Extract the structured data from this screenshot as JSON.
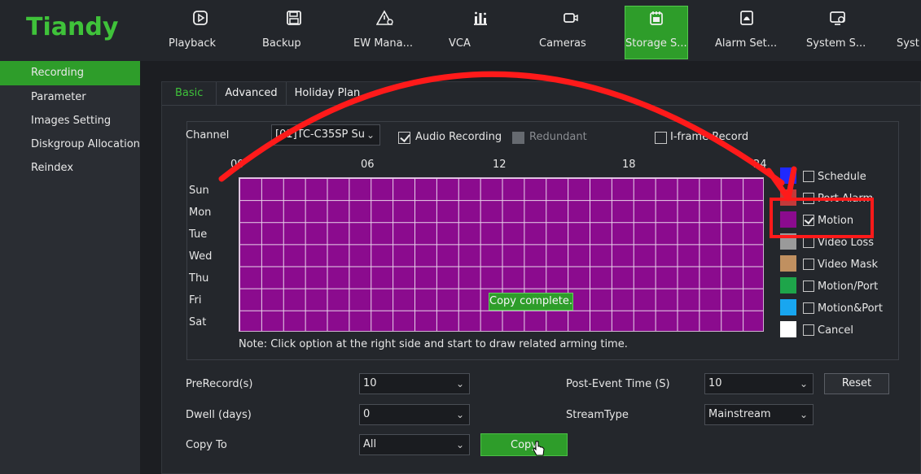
{
  "app": {
    "logo": "Tiandy"
  },
  "nav": [
    {
      "label": "Playback",
      "icon": "playback-icon"
    },
    {
      "label": "Backup",
      "icon": "save-icon"
    },
    {
      "label": "EW Mana...",
      "icon": "warning-icon"
    },
    {
      "label": "VCA",
      "icon": "chart-icon"
    },
    {
      "label": "Cameras",
      "icon": "camera-icon"
    },
    {
      "label": "Storage S...",
      "icon": "storage-icon",
      "active": true
    },
    {
      "label": "Alarm Set...",
      "icon": "alarm-icon"
    },
    {
      "label": "System S...",
      "icon": "system-icon"
    },
    {
      "label": "Syst",
      "icon": ""
    }
  ],
  "sidebar": [
    {
      "label": "Recording",
      "active": true
    },
    {
      "label": "Parameter"
    },
    {
      "label": "Images Setting"
    },
    {
      "label": "Diskgroup Allocation"
    },
    {
      "label": "Reindex"
    }
  ],
  "tabs": [
    {
      "label": "Basic",
      "active": true
    },
    {
      "label": "Advanced"
    },
    {
      "label": "Holiday Plan"
    }
  ],
  "channel": {
    "label": "Channel",
    "value": "[01]TC-C35SP Su",
    "audio_recording": {
      "label": "Audio Recording",
      "checked": true
    },
    "redundant": {
      "label": "Redundant",
      "checked": false,
      "disabled": true
    },
    "iframe": {
      "label": "I-frame Record",
      "checked": false
    }
  },
  "schedule": {
    "hours": [
      "00",
      "06",
      "12",
      "18",
      "24"
    ],
    "days": [
      "Sun",
      "Mon",
      "Tue",
      "Wed",
      "Thu",
      "Fri",
      "Sat"
    ],
    "fill_color": "#8b0b8e",
    "note": "Note: Click option at the right side and start to draw related arming time.",
    "toast": "Copy complete."
  },
  "legend": [
    {
      "label": "Schedule",
      "color": "#1f29ff",
      "checked": false
    },
    {
      "label": "Port Alarm",
      "color": "#c23a3a",
      "checked": false
    },
    {
      "label": "Motion",
      "color": "#8b0b8e",
      "checked": true
    },
    {
      "label": "Video Loss",
      "color": "#9a9a9a",
      "checked": false
    },
    {
      "label": "Video Mask",
      "color": "#c09060",
      "checked": false
    },
    {
      "label": "Motion/Port",
      "color": "#1ea54a",
      "checked": false
    },
    {
      "label": "Motion&Port",
      "color": "#18a6f0",
      "checked": false
    },
    {
      "label": "Cancel",
      "color": "#ffffff",
      "checked": false
    }
  ],
  "form": {
    "prerecord": {
      "label": "PreRecord(s)",
      "value": "10"
    },
    "dwell": {
      "label": "Dwell (days)",
      "value": "0"
    },
    "copy_to": {
      "label": "Copy To",
      "value": "All"
    },
    "post_event": {
      "label": "Post-Event Time (S)",
      "value": "10"
    },
    "stream_type": {
      "label": "StreamType",
      "value": "Mainstream"
    },
    "reset_label": "Reset",
    "copy_label": "Copy"
  },
  "annotation_color": "#ff1a1a"
}
